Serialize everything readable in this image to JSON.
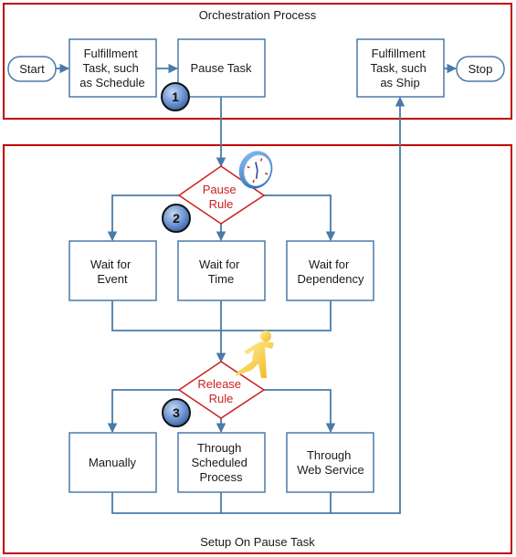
{
  "frames": {
    "orchestration": {
      "title": "Orchestration Process"
    },
    "setup": {
      "title": "Setup On Pause Task"
    }
  },
  "orchestration": {
    "start": "Start",
    "fulfillment_schedule": [
      "Fulfillment",
      "Task, such",
      "as Schedule"
    ],
    "pause_task": [
      "Pause Task"
    ],
    "fulfillment_ship": [
      "Fulfillment",
      "Task, such",
      "as Ship"
    ],
    "stop": "Stop"
  },
  "pause_rule": {
    "label": [
      "Pause",
      "Rule"
    ],
    "icon": "clock-icon",
    "options": [
      [
        "Wait for",
        "Event"
      ],
      [
        "Wait for",
        "Time"
      ],
      [
        "Wait for",
        "Dependency"
      ]
    ]
  },
  "release_rule": {
    "label": [
      "Release",
      "Rule"
    ],
    "icon": "running-person-icon",
    "options": [
      [
        "Manually"
      ],
      [
        "Through",
        "Scheduled",
        "Process"
      ],
      [
        "Through",
        "Web Service"
      ]
    ]
  },
  "badges": [
    "1",
    "2",
    "3"
  ],
  "colors": {
    "frame": "#c00000",
    "box_border": "#4a7aa8",
    "connector": "#4a7aa8",
    "rule_text": "#cc1f1f",
    "badge_fill": "#6f93cf"
  }
}
